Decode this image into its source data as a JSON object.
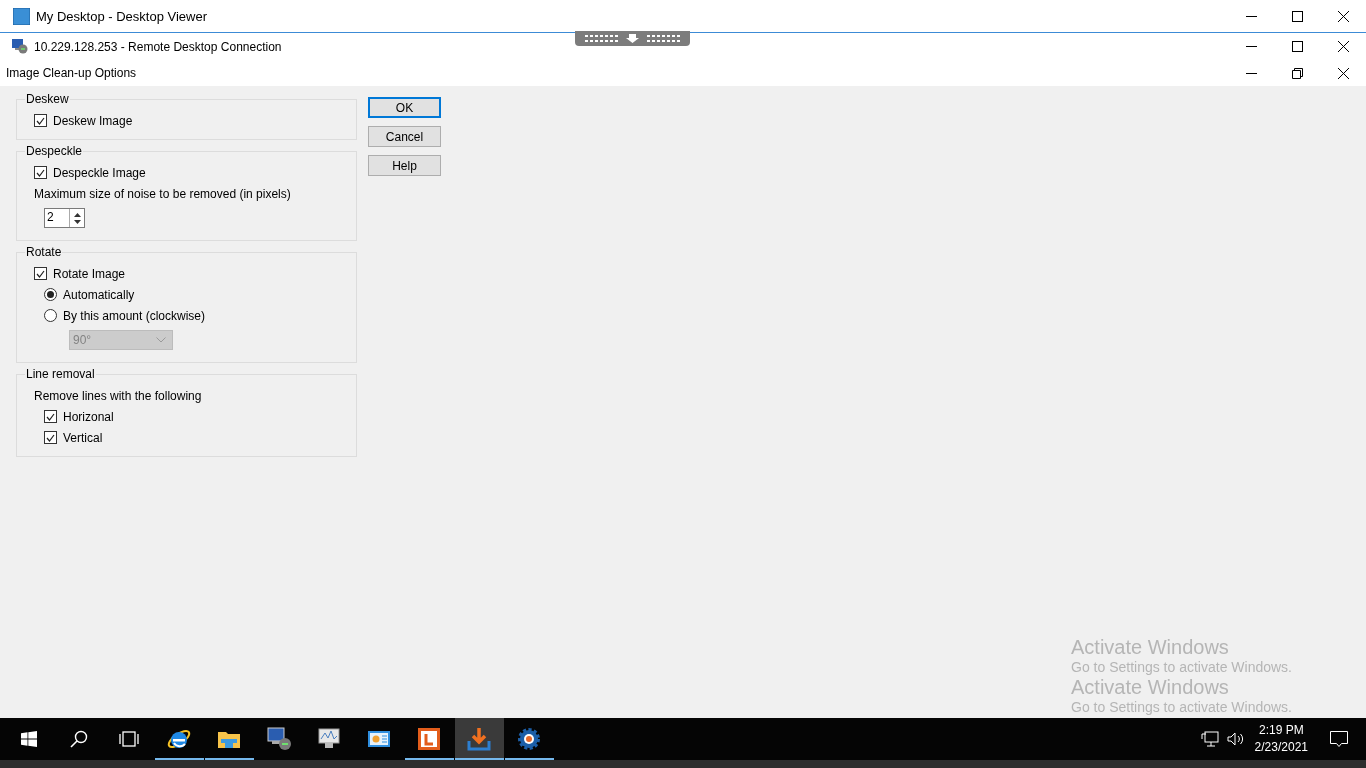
{
  "outer_window": {
    "title": "My Desktop - Desktop Viewer"
  },
  "remote_window": {
    "title": "10.229.128.253 - Remote Desktop Connection"
  },
  "dialog": {
    "title": "Image Clean-up Options",
    "groups": [
      {
        "title": "Deskew",
        "items": [
          {
            "kind": "checkbox",
            "label": "Deskew Image",
            "checked": true
          }
        ]
      },
      {
        "title": "Despeckle",
        "items": [
          {
            "kind": "checkbox",
            "label": "Despeckle Image",
            "checked": true
          },
          {
            "kind": "label",
            "label": "Maximum size of noise to be removed (in pixels)",
            "children": [
              {
                "kind": "spinner",
                "value": "2"
              }
            ]
          }
        ]
      },
      {
        "title": "Rotate",
        "items": [
          {
            "kind": "checkbox",
            "label": "Rotate Image",
            "checked": true,
            "children": [
              {
                "kind": "radio",
                "label": "Automatically",
                "selected": true
              },
              {
                "kind": "radio",
                "label": "By this amount (clockwise)",
                "selected": false,
                "children": [
                  {
                    "kind": "dropdown",
                    "value": "90°",
                    "disabled": true
                  }
                ]
              }
            ]
          }
        ]
      },
      {
        "title": "Line removal",
        "items": [
          {
            "kind": "label",
            "label": "Remove lines with the following",
            "children": [
              {
                "kind": "checkbox",
                "label": "Horizonal",
                "checked": true
              },
              {
                "kind": "checkbox",
                "label": "Vertical",
                "checked": true
              }
            ]
          }
        ]
      }
    ],
    "buttons": [
      {
        "label": "OK",
        "default": true
      },
      {
        "label": "Cancel",
        "default": false
      },
      {
        "label": "Help",
        "default": false
      }
    ]
  },
  "activation_notices": [
    {
      "heading": "Activate Windows",
      "text": "Go to Settings to activate Windows."
    },
    {
      "heading": "Activate Windows",
      "text": "Go to Settings to activate Windows."
    }
  ],
  "taskbar": {
    "items": [
      {
        "kind": "start",
        "running": false,
        "selected": false
      },
      {
        "kind": "search",
        "running": false,
        "selected": false
      },
      {
        "kind": "taskview",
        "running": false,
        "selected": false
      },
      {
        "kind": "browser",
        "running": true,
        "selected": false
      },
      {
        "kind": "folder",
        "running": true,
        "selected": false
      },
      {
        "kind": "remote",
        "running": false,
        "selected": false
      },
      {
        "kind": "monitor",
        "running": false,
        "selected": false
      },
      {
        "kind": "panel",
        "running": false,
        "selected": false
      },
      {
        "kind": "letter",
        "running": true,
        "selected": false
      },
      {
        "kind": "download",
        "running": true,
        "selected": true
      },
      {
        "kind": "gear",
        "running": true,
        "selected": false
      }
    ],
    "clock": {
      "time": "2:19 PM",
      "date": "2/23/2021"
    }
  }
}
